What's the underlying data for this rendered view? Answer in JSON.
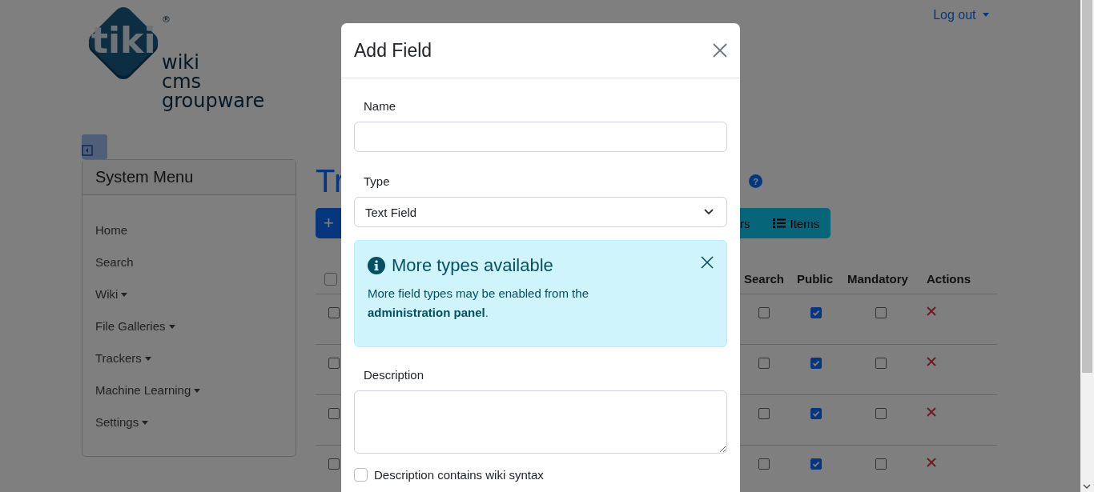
{
  "logo": {
    "mark": "tiki",
    "registered": "®",
    "lines": [
      "wiki",
      "cms",
      "groupware"
    ]
  },
  "user_menu": {
    "label": "Log out"
  },
  "system_menu": {
    "title": "System Menu",
    "items": [
      {
        "label": "Home",
        "has_submenu": false
      },
      {
        "label": "Search",
        "has_submenu": false
      },
      {
        "label": "Wiki",
        "has_submenu": true
      },
      {
        "label": "File Galleries",
        "has_submenu": true
      },
      {
        "label": "Trackers",
        "has_submenu": true
      },
      {
        "label": "Machine Learning",
        "has_submenu": true
      },
      {
        "label": "Settings",
        "has_submenu": true
      }
    ]
  },
  "page_title": "Tr",
  "help": {
    "label": "?"
  },
  "toolbar": {
    "add_label": "+",
    "buttons": [
      {
        "label": "rs",
        "kind": "text"
      },
      {
        "label": "Items",
        "kind": "list"
      }
    ]
  },
  "table": {
    "select_all": false,
    "columns": [
      "Search",
      "Public",
      "Mandatory",
      "Actions"
    ],
    "rows": [
      {
        "selected": false,
        "search": false,
        "public": true,
        "mandatory": false
      },
      {
        "selected": false,
        "search": false,
        "public": true,
        "mandatory": false
      },
      {
        "selected": false,
        "search": false,
        "public": true,
        "mandatory": false
      },
      {
        "selected": false,
        "search": false,
        "public": true,
        "mandatory": false
      }
    ]
  },
  "modal": {
    "title": "Add Field",
    "name": {
      "label": "Name"
    },
    "type": {
      "label": "Type",
      "value": "Text Field"
    },
    "alert": {
      "title": "More types available",
      "text": "More field types may be enabled from the **administration panel**."
    },
    "description": {
      "label": "Description"
    },
    "options": [
      {
        "label": "Description contains wiki syntax",
        "checked": false
      }
    ]
  }
}
